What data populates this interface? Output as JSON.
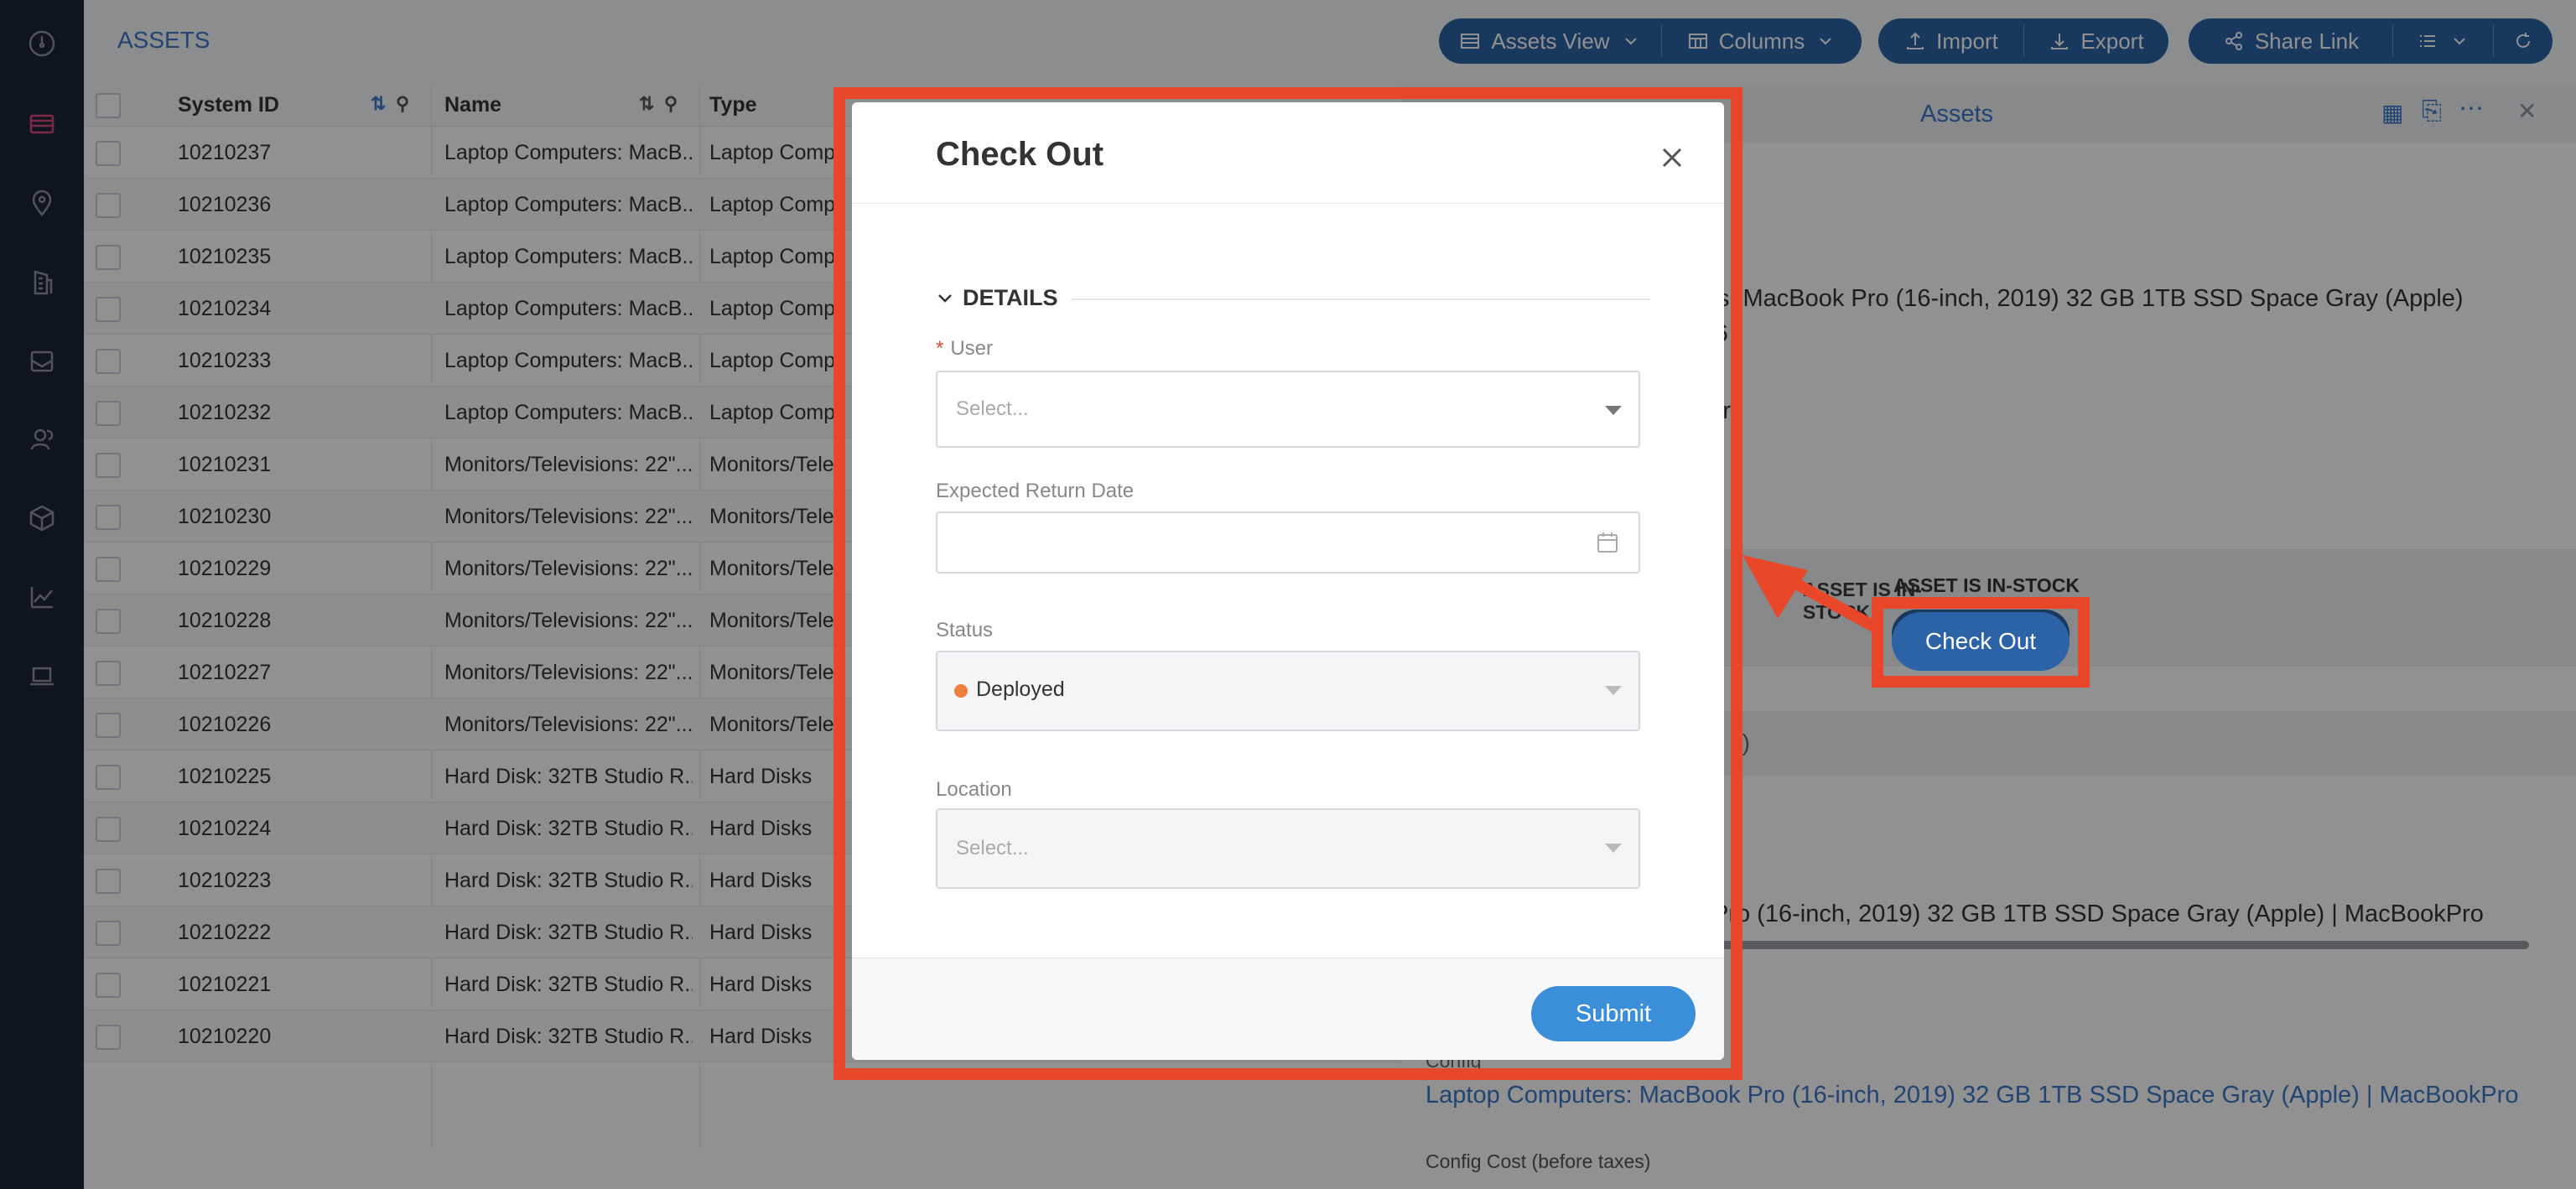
{
  "toolbar": {
    "title": "ASSETS",
    "assets_view": "Assets View",
    "columns": "Columns",
    "import": "Import",
    "export": "Export",
    "share_link": "Share Link"
  },
  "grid": {
    "headers": [
      "System ID",
      "Name",
      "Type"
    ],
    "rows": [
      {
        "id": "10210237",
        "name": "Laptop Computers: MacB...",
        "type": "Laptop Comp"
      },
      {
        "id": "10210236",
        "name": "Laptop Computers: MacB...",
        "type": "Laptop Comp"
      },
      {
        "id": "10210235",
        "name": "Laptop Computers: MacB...",
        "type": "Laptop Comp"
      },
      {
        "id": "10210234",
        "name": "Laptop Computers: MacB...",
        "type": "Laptop Comp"
      },
      {
        "id": "10210233",
        "name": "Laptop Computers: MacB...",
        "type": "Laptop Comp"
      },
      {
        "id": "10210232",
        "name": "Laptop Computers: MacB...",
        "type": "Laptop Comp"
      },
      {
        "id": "10210231",
        "name": "Monitors/Televisions: 22\"...",
        "type": "Monitors/Tele"
      },
      {
        "id": "10210230",
        "name": "Monitors/Televisions: 22\"...",
        "type": "Monitors/Tele"
      },
      {
        "id": "10210229",
        "name": "Monitors/Televisions: 22\"...",
        "type": "Monitors/Tele"
      },
      {
        "id": "10210228",
        "name": "Monitors/Televisions: 22\"...",
        "type": "Monitors/Tele"
      },
      {
        "id": "10210227",
        "name": "Monitors/Televisions: 22\"...",
        "type": "Monitors/Tele"
      },
      {
        "id": "10210226",
        "name": "Monitors/Televisions: 22\"...",
        "type": "Monitors/Tele"
      },
      {
        "id": "10210225",
        "name": "Hard Disk: 32TB Studio R...",
        "type": "Hard Disks"
      },
      {
        "id": "10210224",
        "name": "Hard Disk: 32TB Studio R...",
        "type": "Hard Disks"
      },
      {
        "id": "10210223",
        "name": "Hard Disk: 32TB Studio R...",
        "type": "Hard Disks"
      },
      {
        "id": "10210222",
        "name": "Hard Disk: 32TB Studio R...",
        "type": "Hard Disks"
      },
      {
        "id": "10210221",
        "name": "Hard Disk: 32TB Studio R...",
        "type": "Hard Disks"
      },
      {
        "id": "10210220",
        "name": "Hard Disk: 32TB Studio R...",
        "type": "Hard Disks"
      }
    ]
  },
  "panel": {
    "title": "Assets",
    "name_line1": "ters: MacBook Pro (16-inch, 2019) 32 GB 1TB SSD Space Gray (Apple)",
    "name_line2": "c16",
    "category": "nters",
    "stock_label": "ASSET IS IN-STOCK",
    "checkout_button": "Check Out",
    "count_text": "1)",
    "config_desc": "Pro (16-inch, 2019) 32 GB 1TB SSD Space Gray (Apple) | MacBookPro",
    "config_label": "Config",
    "config_link": "Laptop Computers: MacBook Pro (16-inch, 2019) 32 GB 1TB SSD Space Gray (Apple) | MacBookPro",
    "config_cost_label": "Config Cost (before taxes)"
  },
  "modal": {
    "title": "Check Out",
    "section": "DETAILS",
    "user_label": "User",
    "user_placeholder": "Select...",
    "return_label": "Expected Return Date",
    "status_label": "Status",
    "status_value": "Deployed",
    "location_label": "Location",
    "location_placeholder": "Select...",
    "submit": "Submit"
  },
  "colors": {
    "accent": "#2b63a6",
    "annotation": "#e8472a",
    "status_dot": "#ef7f3a",
    "submit": "#3b8ed8"
  }
}
